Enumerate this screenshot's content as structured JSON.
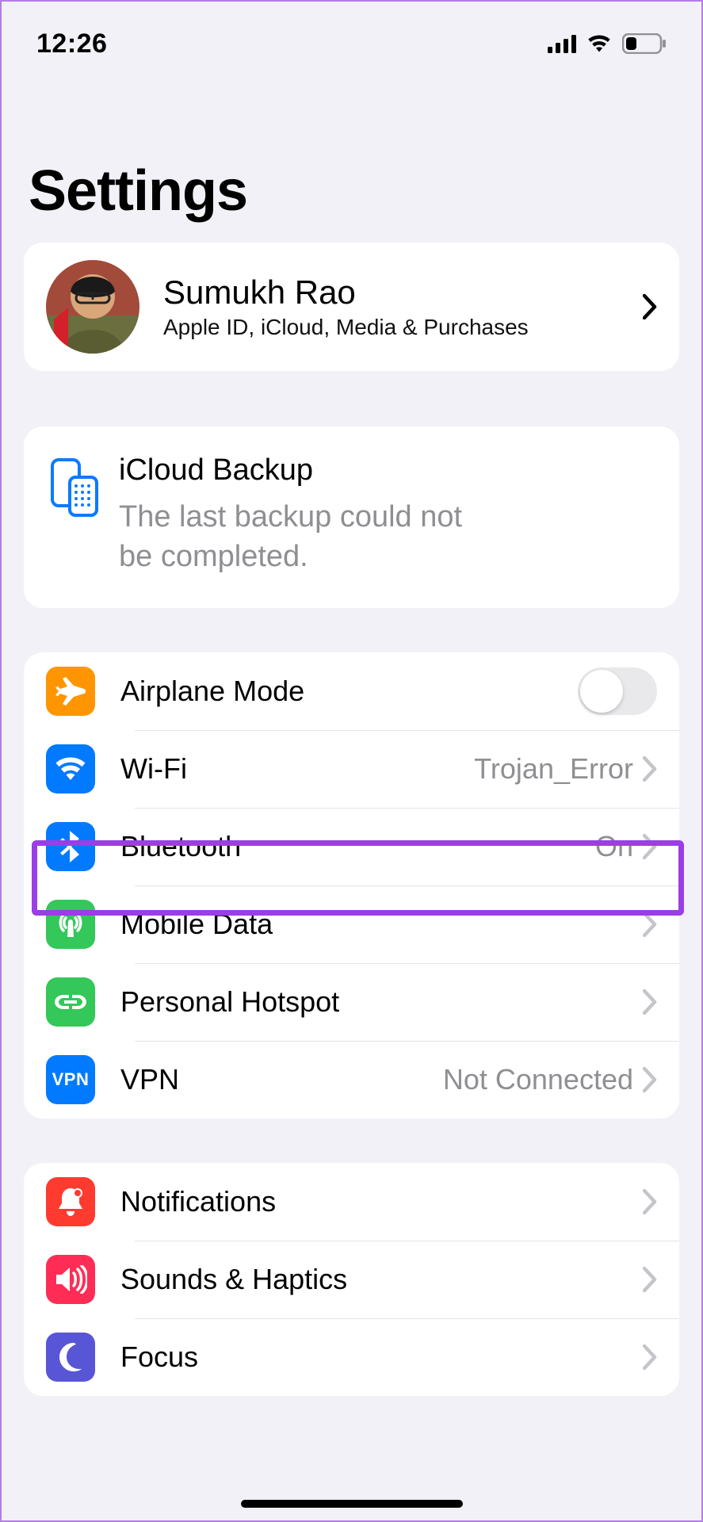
{
  "status": {
    "time": "12:26"
  },
  "title": "Settings",
  "profile": {
    "name": "Sumukh Rao",
    "subtitle": "Apple ID, iCloud, Media & Purchases"
  },
  "backup": {
    "title": "iCloud Backup",
    "subtitle": "The last backup could not be completed."
  },
  "connectivity": {
    "airplane": "Airplane Mode",
    "wifi": {
      "label": "Wi-Fi",
      "value": "Trojan_Error"
    },
    "bluetooth": {
      "label": "Bluetooth",
      "value": "On"
    },
    "mobile_data": "Mobile Data",
    "hotspot": "Personal Hotspot",
    "vpn": {
      "label": "VPN",
      "value": "Not Connected",
      "badge": "VPN"
    }
  },
  "alerts": {
    "notifications": "Notifications",
    "sounds": "Sounds & Haptics",
    "focus": "Focus"
  }
}
